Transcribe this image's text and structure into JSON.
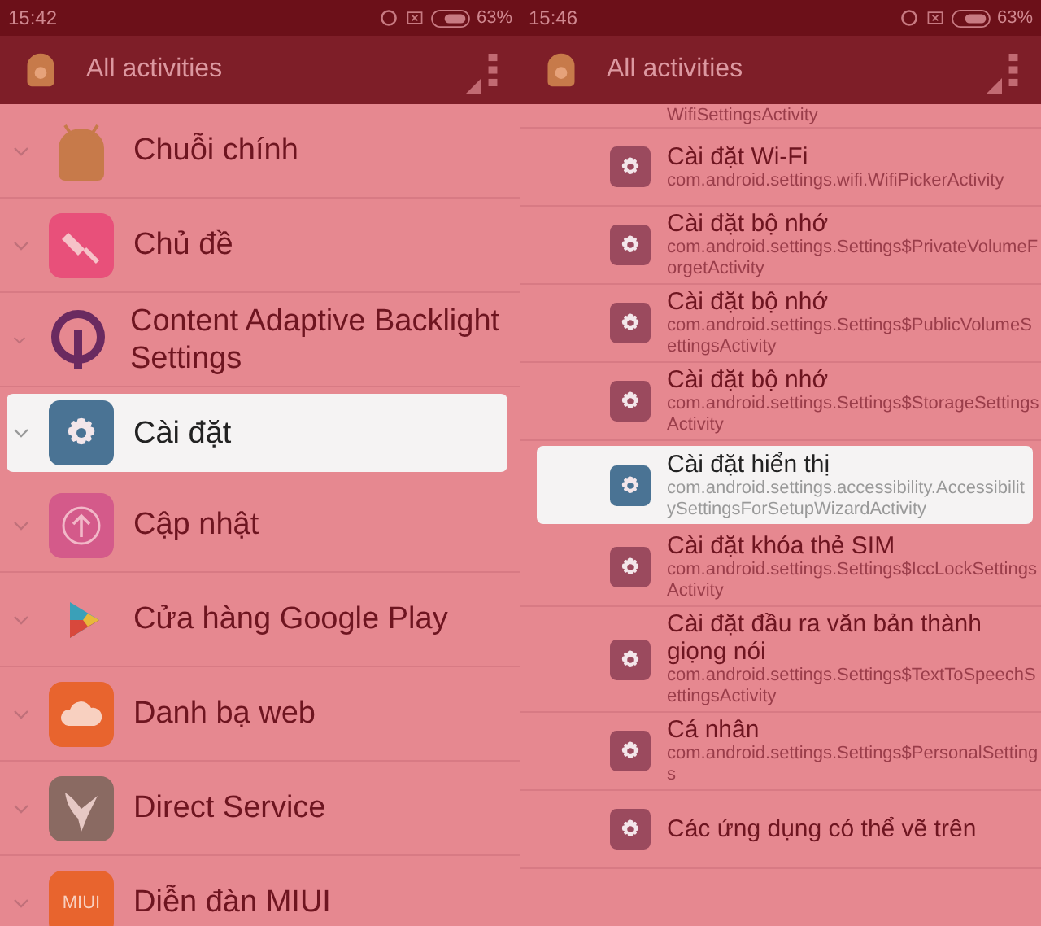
{
  "panels": [
    {
      "status_bar": {
        "time": "15:42",
        "battery": "63%"
      },
      "header": {
        "title": "All activities"
      },
      "list": {
        "kind": "apps",
        "items": [
          {
            "kind": "android",
            "title": "Chuỗi chính",
            "selected": false
          },
          {
            "kind": "theme",
            "title": "Chủ đề",
            "selected": false
          },
          {
            "kind": "qlogo",
            "title": "Content Adaptive Backlight Settings",
            "selected": false
          },
          {
            "kind": "gear",
            "title": "Cài đặt",
            "selected": true
          },
          {
            "kind": "update",
            "title": "Cập nhật",
            "selected": false
          },
          {
            "kind": "play",
            "title": "Cửa hàng Google Play",
            "selected": false
          },
          {
            "kind": "cloud",
            "title": "Danh bạ web",
            "selected": false
          },
          {
            "kind": "bird",
            "title": "Direct Service",
            "selected": false
          },
          {
            "kind": "miui",
            "title": "Diễn đàn MIUI",
            "icon_text": "MIUI",
            "selected": false
          }
        ]
      }
    },
    {
      "status_bar": {
        "time": "15:46",
        "battery": "63%"
      },
      "header": {
        "title": "All activities"
      },
      "list": {
        "kind": "activities",
        "items": [
          {
            "kind": "cut",
            "subtitle": "WifiSettingsActivity",
            "selected": false
          },
          {
            "kind": "gear",
            "title": "Cài đặt Wi-Fi",
            "subtitle": "com.android.settings.wifi.WifiPickerActivity",
            "selected": false
          },
          {
            "kind": "gear",
            "title": "Cài đặt bộ nhớ",
            "subtitle": "com.android.settings.Settings$PrivateVolumeForgetActivity",
            "selected": false
          },
          {
            "kind": "gear",
            "title": "Cài đặt bộ nhớ",
            "subtitle": "com.android.settings.Settings$PublicVolumeSettingsActivity",
            "selected": false
          },
          {
            "kind": "gear",
            "title": "Cài đặt bộ nhớ",
            "subtitle": "com.android.settings.Settings$StorageSettingsActivity",
            "selected": false
          },
          {
            "kind": "gear",
            "title": "Cài đặt hiển thị",
            "subtitle": "com.android.settings.accessibility.AccessibilitySettingsForSetupWizardActivity",
            "selected": true
          },
          {
            "kind": "gear",
            "title": "Cài đặt khóa thẻ SIM",
            "subtitle": "com.android.settings.Settings$IccLockSettingsActivity",
            "selected": false
          },
          {
            "kind": "gear",
            "title": "Cài đặt đầu ra văn bản thành giọng nói",
            "subtitle": "com.android.settings.Settings$TextToSpeechSettingsActivity",
            "selected": false
          },
          {
            "kind": "gear",
            "title": "Cá nhân",
            "subtitle": "com.android.settings.Settings$PersonalSettings",
            "selected": false
          },
          {
            "kind": "gear",
            "title": "Các ứng dụng có thể vẽ trên",
            "selected": false
          }
        ]
      }
    }
  ]
}
